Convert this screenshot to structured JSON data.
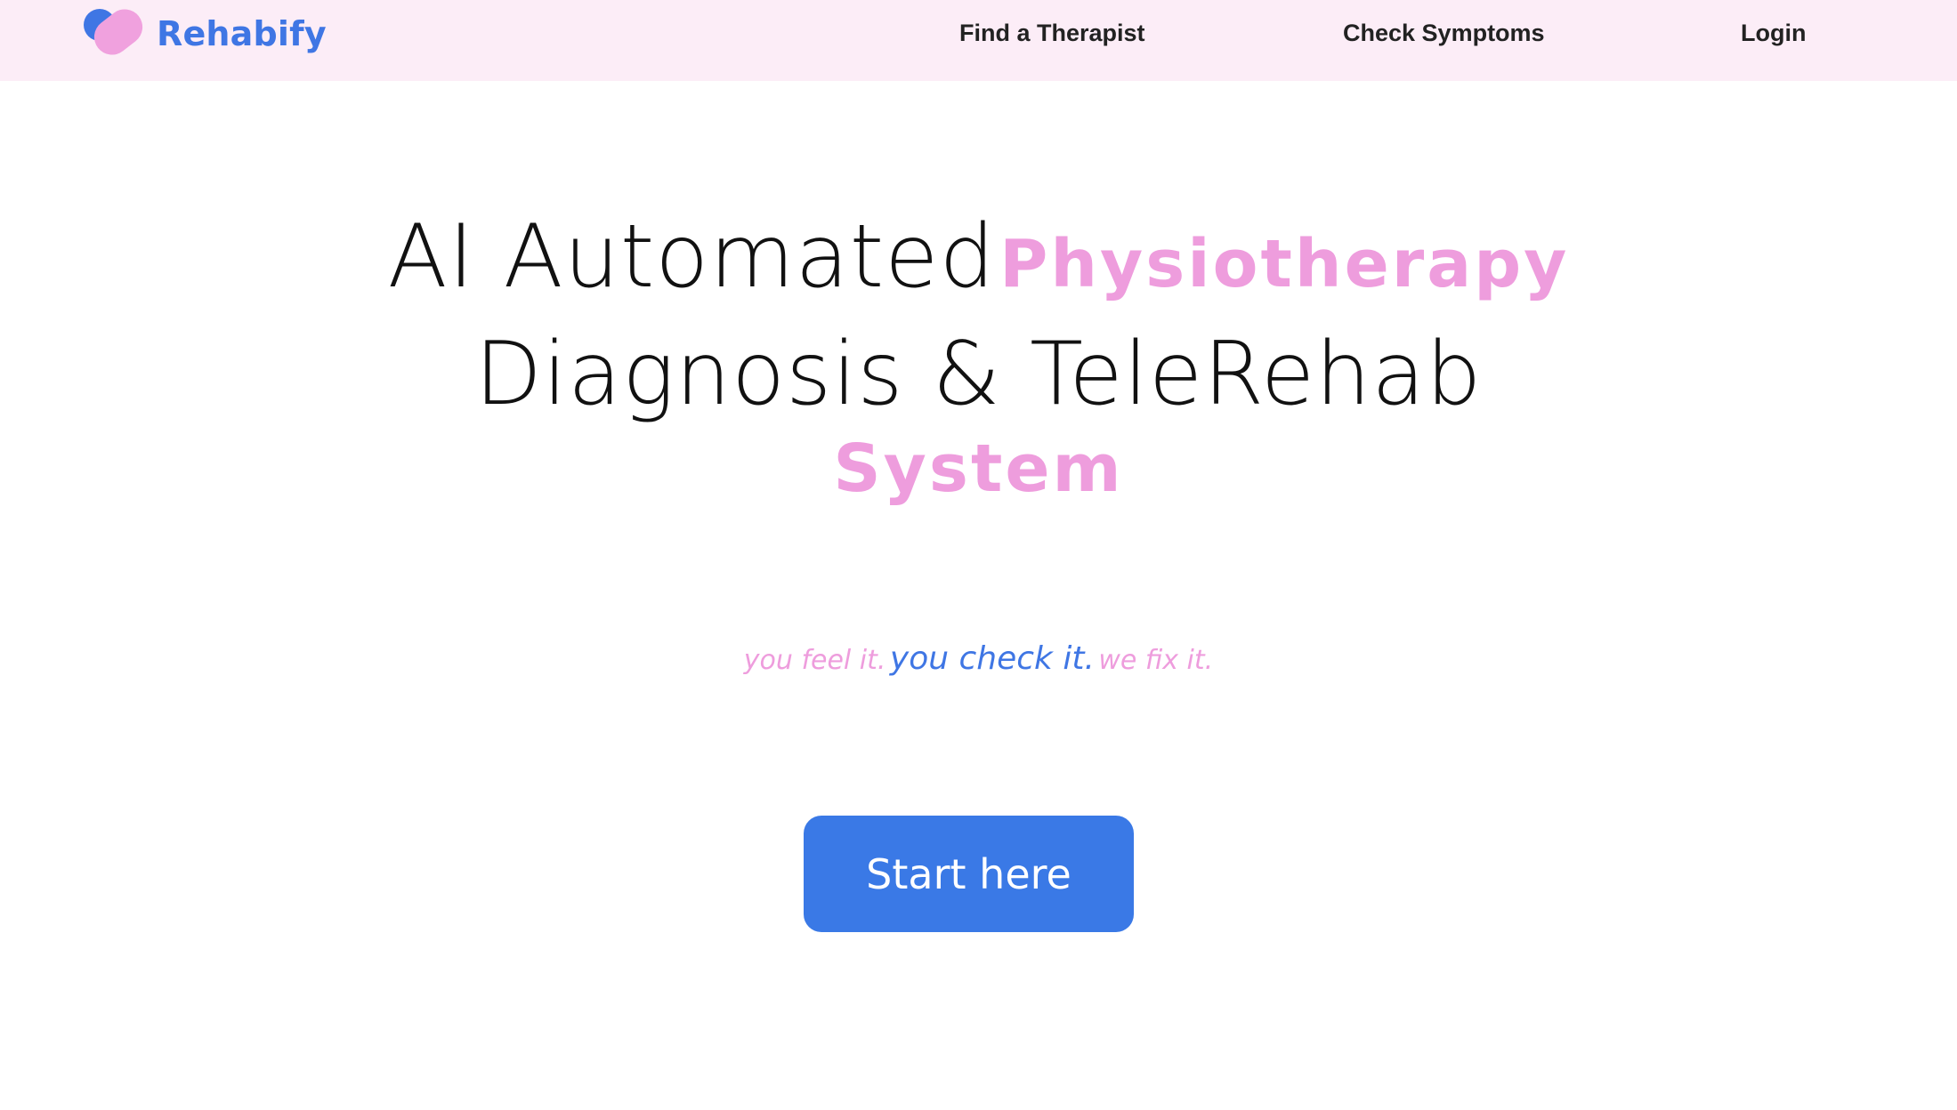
{
  "brand": {
    "name": "Rehabify",
    "logo_icon": "heart-pill-logo-icon"
  },
  "nav": {
    "find_therapist": "Find a Therapist",
    "check_symptoms": "Check Symptoms",
    "login": "Login"
  },
  "hero": {
    "line1_thin": "AI Automated",
    "line1_pink": "Physiotherapy",
    "line2_thin": "Diagnosis & TeleRehab",
    "line3_pink": "System"
  },
  "tagline": {
    "part1": "you feel it.",
    "part2": "you check it.",
    "part3": "we fix it."
  },
  "cta": {
    "label": "Start here"
  },
  "colors": {
    "nav_background": "#fcedf7",
    "brand_blue": "#3f76e4",
    "brand_pink": "#ee9ddd",
    "button_blue": "#3a79e6"
  }
}
